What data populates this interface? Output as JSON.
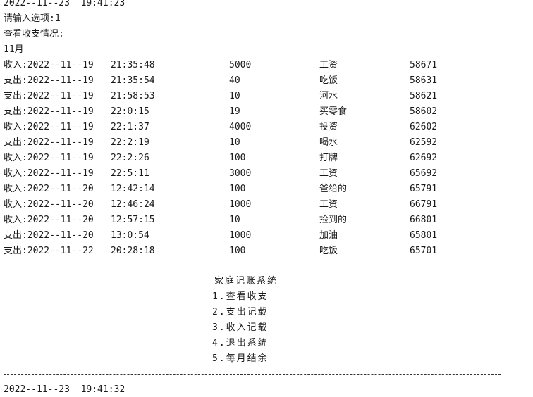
{
  "header_time": "2022--11--23  19:41:23",
  "prompt_line": "请输入选项:1",
  "view_heading": "查看收支情况:",
  "month_label": "11月",
  "records": [
    {
      "type": "收入:2022--11--19",
      "time": "21:35:48",
      "amount": "5000",
      "note": "工资",
      "balance": "58671"
    },
    {
      "type": "支出:2022--11--19",
      "time": "21:35:54",
      "amount": "40",
      "note": "吃饭",
      "balance": "58631"
    },
    {
      "type": "支出:2022--11--19",
      "time": "21:58:53",
      "amount": "10",
      "note": "河水",
      "balance": "58621"
    },
    {
      "type": "支出:2022--11--19",
      "time": "22:0:15",
      "amount": "19",
      "note": "买零食",
      "balance": "58602"
    },
    {
      "type": "收入:2022--11--19",
      "time": "22:1:37",
      "amount": "4000",
      "note": "投资",
      "balance": "62602"
    },
    {
      "type": "支出:2022--11--19",
      "time": "22:2:19",
      "amount": "10",
      "note": "喝水",
      "balance": "62592"
    },
    {
      "type": "收入:2022--11--19",
      "time": "22:2:26",
      "amount": "100",
      "note": "打牌",
      "balance": "62692"
    },
    {
      "type": "收入:2022--11--19",
      "time": "22:5:11",
      "amount": "3000",
      "note": "工资",
      "balance": "65692"
    },
    {
      "type": "收入:2022--11--20",
      "time": "12:42:14",
      "amount": "100",
      "note": "爸给的",
      "balance": "65791"
    },
    {
      "type": "收入:2022--11--20",
      "time": "12:46:24",
      "amount": "1000",
      "note": "工资",
      "balance": "66791"
    },
    {
      "type": "收入:2022--11--20",
      "time": "12:57:15",
      "amount": "10",
      "note": "捡到的",
      "balance": "66801"
    },
    {
      "type": "支出:2022--11--20",
      "time": "13:0:54",
      "amount": "1000",
      "note": "加油",
      "balance": "65801"
    },
    {
      "type": "支出:2022--11--22",
      "time": "20:28:18",
      "amount": "100",
      "note": "吃饭",
      "balance": "65701"
    }
  ],
  "menu": {
    "title": "家庭记账系统",
    "items": [
      "1.查看收支",
      "2.支出记载",
      "3.收入记载",
      "4.退出系统",
      "5.每月结余"
    ]
  },
  "footer_time": "2022--11--23  19:41:32"
}
